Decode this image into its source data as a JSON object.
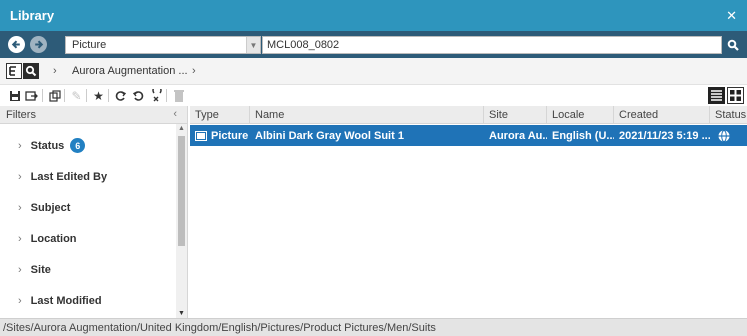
{
  "window": {
    "title": "Library",
    "close_icon": "close-icon"
  },
  "search": {
    "type_value": "Picture",
    "query_value": "MCL008_0802"
  },
  "breadcrumb": {
    "item": "Aurora Augmentation ..."
  },
  "filters": {
    "header": "Filters",
    "items": [
      {
        "label": "Status",
        "badge": "6"
      },
      {
        "label": "Last Edited By"
      },
      {
        "label": "Subject"
      },
      {
        "label": "Location"
      },
      {
        "label": "Site"
      },
      {
        "label": "Last Modified"
      }
    ]
  },
  "table": {
    "columns": [
      "Type",
      "Name",
      "Site",
      "Locale",
      "Created",
      "Status"
    ],
    "rows": [
      {
        "type": "Picture",
        "name": "Albini Dark Gray Wool Suit 1",
        "site": "Aurora Au...",
        "locale": "English (U...",
        "created": "2021/11/23 5:19 ...",
        "status_icon": "published-globe-icon"
      }
    ]
  },
  "status_path": "/Sites/Aurora Augmentation/United Kingdom/English/Pictures/Product Pictures/Men/Suits",
  "colors": {
    "titlebar": "#2e95bd",
    "searchbar": "#2d5b78",
    "selection": "#1f73b7",
    "badge": "#2280c2"
  }
}
